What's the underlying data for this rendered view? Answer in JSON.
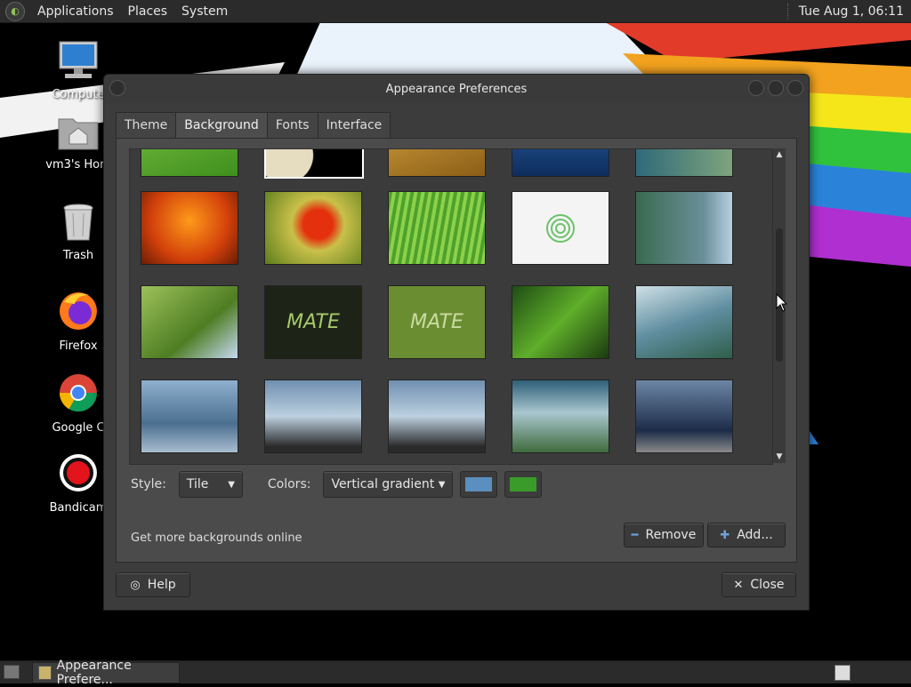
{
  "top_panel": {
    "menus": [
      "Applications",
      "Places",
      "System"
    ],
    "clock": "Tue Aug  1, 06:11"
  },
  "desktop": {
    "icons": [
      {
        "label": "Compute",
        "icon": "computer-icon"
      },
      {
        "label": "vm3's Hom",
        "icon": "home-folder-icon"
      },
      {
        "label": "Trash",
        "icon": "trash-icon"
      },
      {
        "label": "Firefox",
        "icon": "firefox-icon"
      },
      {
        "label": "Google C",
        "icon": "chrome-icon"
      },
      {
        "label": "Bandicam",
        "icon": "bandicam-icon"
      }
    ]
  },
  "dialog": {
    "title": "Appearance Preferences",
    "tabs": [
      "Theme",
      "Background",
      "Fonts",
      "Interface"
    ],
    "active_tab": "Background",
    "thumbnails_watermark": "MATE",
    "style_label": "Style:",
    "style_value": "Tile",
    "colors_label": "Colors:",
    "colors_value": "Vertical gradient",
    "color1": "#5b8fbf",
    "color2": "#3a9a2a",
    "more_link": "Get more backgrounds online",
    "remove_label": "Remove",
    "add_label": "Add...",
    "help_label": "Help",
    "close_label": "Close"
  },
  "taskbar": {
    "task_label": "Appearance Prefere..."
  }
}
